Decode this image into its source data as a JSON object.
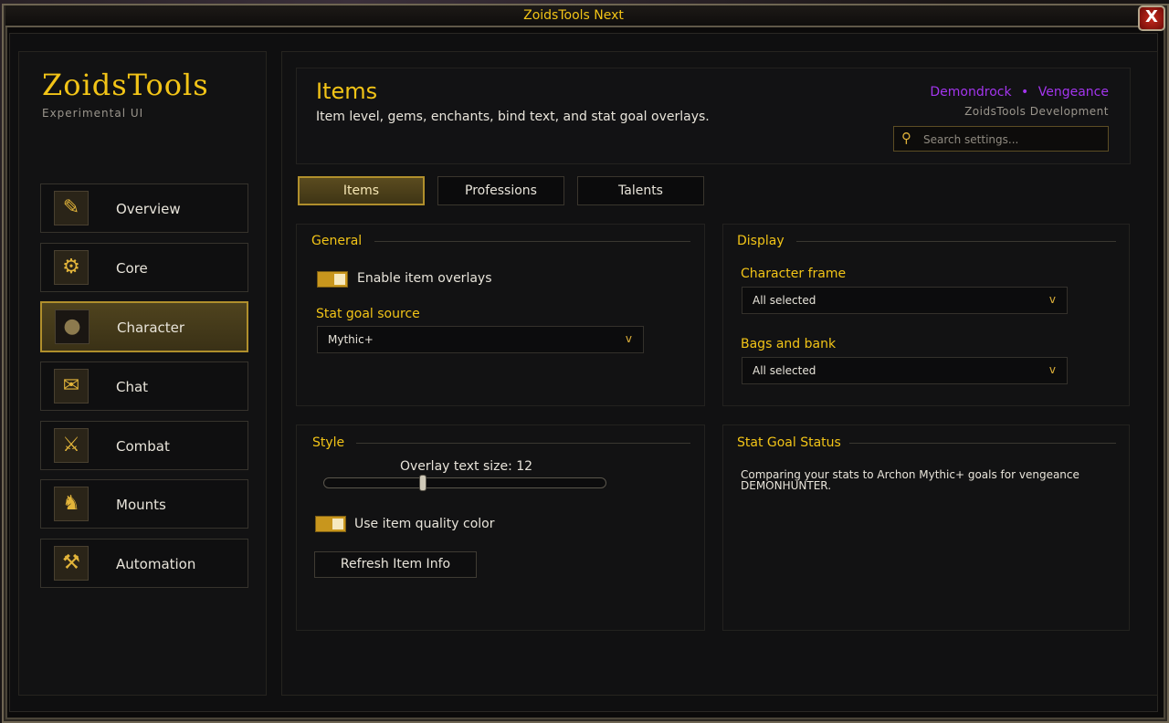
{
  "window": {
    "title": "ZoidsTools Next",
    "close_glyph": "X"
  },
  "brand": {
    "logo": "ZoidsTools",
    "subtitle": "Experimental UI"
  },
  "sidebar": {
    "items": [
      {
        "label": "Overview",
        "icon": "scroll-icon",
        "glyph": "✎"
      },
      {
        "label": "Core",
        "icon": "gear-icon",
        "glyph": "⚙"
      },
      {
        "label": "Character",
        "icon": "person-icon",
        "glyph": "●",
        "active": true
      },
      {
        "label": "Chat",
        "icon": "letter-icon",
        "glyph": "✉"
      },
      {
        "label": "Combat",
        "icon": "crossed-swords-icon",
        "glyph": "⚔"
      },
      {
        "label": "Mounts",
        "icon": "horse-icon",
        "glyph": "♞"
      },
      {
        "label": "Automation",
        "icon": "map-icon",
        "glyph": "⚒"
      }
    ]
  },
  "header": {
    "title": "Items",
    "description": "Item level, gems, enchants, bind text, and stat goal overlays.",
    "character": "Demondrock",
    "separator": "•",
    "spec": "Vengeance",
    "realm": "ZoidsTools Development",
    "search_placeholder": "Search settings..."
  },
  "tabs": [
    {
      "label": "Items",
      "active": true
    },
    {
      "label": "Professions"
    },
    {
      "label": "Talents"
    }
  ],
  "general": {
    "title": "General",
    "enable_overlays_label": "Enable item overlays",
    "enable_overlays": true,
    "stat_goal_source_label": "Stat goal source",
    "stat_goal_source_value": "Mythic+"
  },
  "display": {
    "title": "Display",
    "character_frame_label": "Character frame",
    "character_frame_value": "All selected",
    "bags_label": "Bags and bank",
    "bags_value": "All selected"
  },
  "style": {
    "title": "Style",
    "slider_label": "Overlay text size: 12",
    "slider_value": 12,
    "quality_color_label": "Use item quality color",
    "quality_color": true,
    "refresh_button": "Refresh Item Info"
  },
  "stat_goal_status": {
    "title": "Stat Goal Status",
    "text": "Comparing your stats to Archon Mythic+ goals for vengeance DEMONHUNTER."
  },
  "caret": "v",
  "colors": {
    "accent": "#f2c417",
    "spec": "#a335ee",
    "toggle_on": "#c8961d"
  }
}
